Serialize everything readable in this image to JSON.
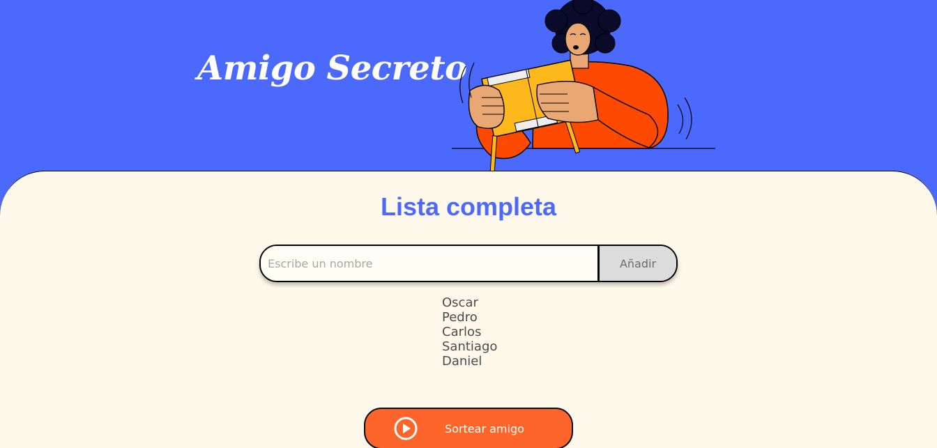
{
  "header": {
    "title": "Amigo Secreto",
    "illustration": "person-holding-gift-illustration"
  },
  "main": {
    "section_title": "Lista completa",
    "input": {
      "placeholder": "Escribe un nombre",
      "value": ""
    },
    "add_button_label": "Añadir",
    "friends": [
      "Oscar",
      "Pedro",
      "Carlos",
      "Santiago",
      "Daniel"
    ],
    "draw_button_label": "Sortear amigo",
    "draw_button_icon": "play-circle-icon"
  },
  "colors": {
    "header_bg": "#4b69fd",
    "main_bg": "#fff9eb",
    "accent_orange": "#fe652b",
    "title_blue": "#4b69fd"
  }
}
